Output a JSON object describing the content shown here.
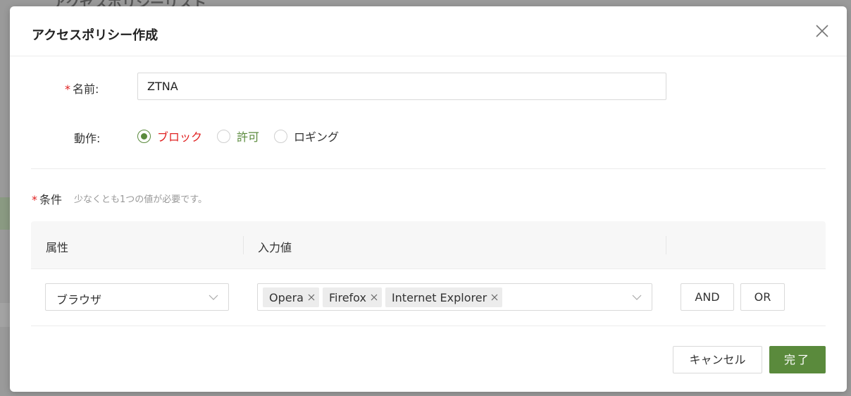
{
  "background": {
    "title": "アクセスポリシーリスト"
  },
  "modal": {
    "title": "アクセスポリシー作成",
    "close_icon": "close-icon"
  },
  "form": {
    "name": {
      "required_mark": "*",
      "label": "名前:",
      "value": "ZTNA"
    },
    "action": {
      "label": "動作:",
      "options": [
        {
          "label": "ブロック",
          "checked": true,
          "color": "#e02020"
        },
        {
          "label": "許可",
          "checked": false,
          "color": "#5a8a3c"
        },
        {
          "label": "ロギング",
          "checked": false,
          "color": "#333333"
        }
      ]
    },
    "conditions": {
      "required_mark": "*",
      "label": "条件",
      "hint": "少なくとも1つの値が必要です。",
      "headers": [
        "属性",
        "入力値",
        ""
      ],
      "row": {
        "attribute": "ブラウザ",
        "values": [
          "Opera",
          "Firefox",
          "Internet Explorer"
        ],
        "and_label": "AND",
        "or_label": "OR"
      }
    }
  },
  "footer": {
    "cancel_label": "キャンセル",
    "ok_label": "完了"
  },
  "colors": {
    "accent": "#5a8a3c",
    "danger": "#e02020"
  }
}
